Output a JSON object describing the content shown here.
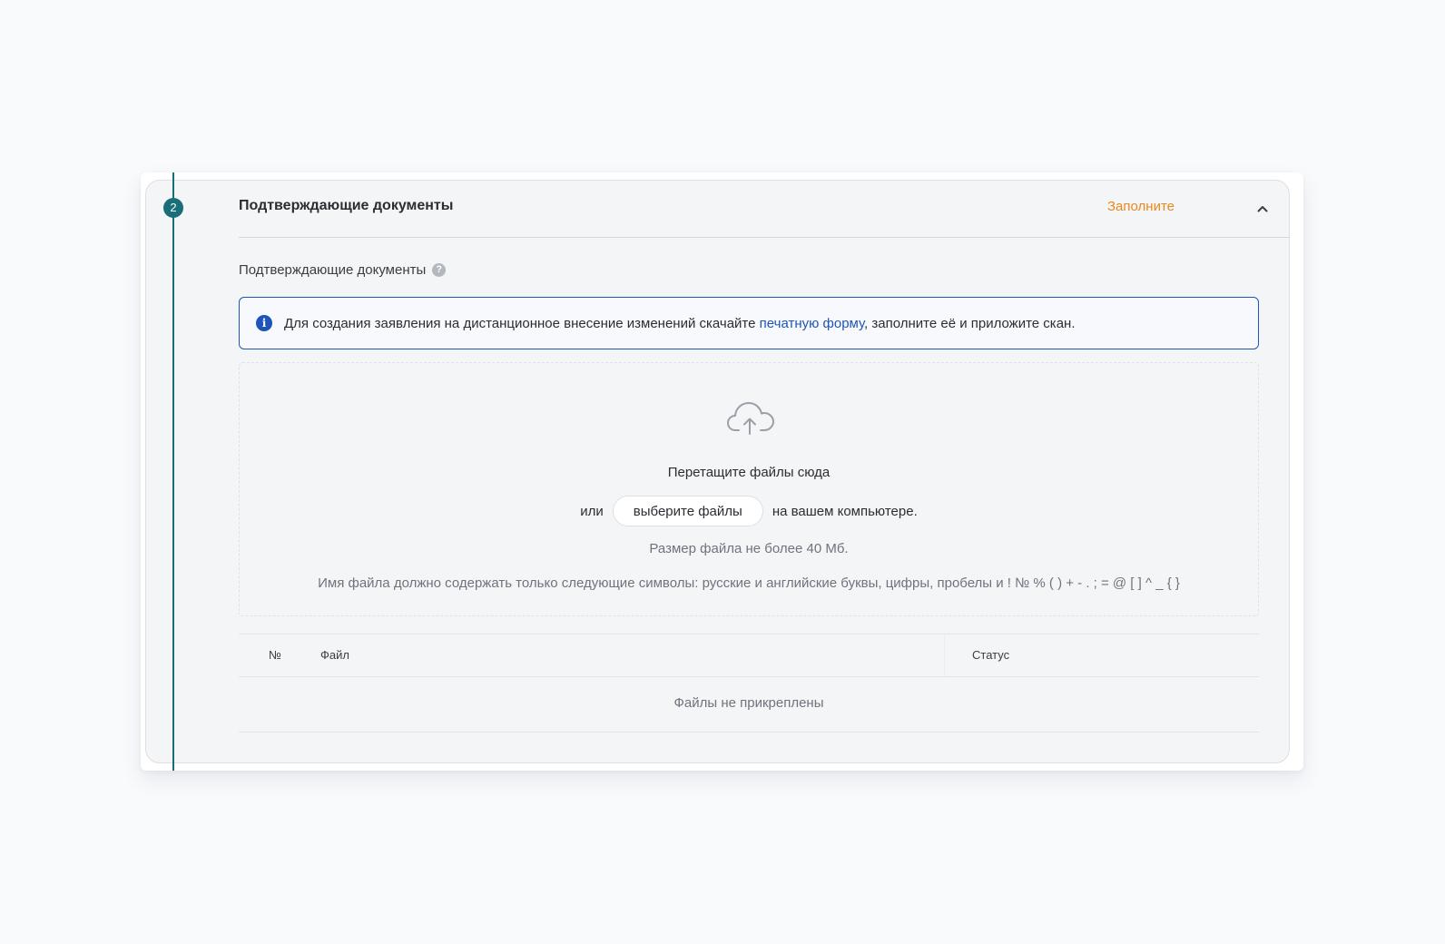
{
  "step": {
    "number": "2",
    "title": "Подтверждающие документы",
    "status": "Заполните"
  },
  "field": {
    "label": "Подтверждающие документы",
    "help": "?"
  },
  "info": {
    "icon": "i",
    "text_before": "Для создания заявления на дистанционное внесение изменений скачайте ",
    "link": "печатную форму",
    "text_after": ", заполните её и приложите скан."
  },
  "dropzone": {
    "icon": "cloud-upload-icon",
    "title": "Перетащите файлы сюда",
    "or": "или",
    "button": "выберите файлы",
    "suffix": "на вашем компьютере.",
    "size_note": "Размер файла не более 40 Мб.",
    "name_note": "Имя файла должно содержать только следующие символы: русские и английские буквы, цифры, пробелы и ! № % ( ) + - . ; = @ [ ] ^ _ { }"
  },
  "table": {
    "columns": [
      "№",
      "Файл",
      "Статус"
    ],
    "empty": "Файлы не прикреплены"
  },
  "colors": {
    "accent": "#1a6e79",
    "status": "#e8891f",
    "info": "#1d55b8"
  }
}
